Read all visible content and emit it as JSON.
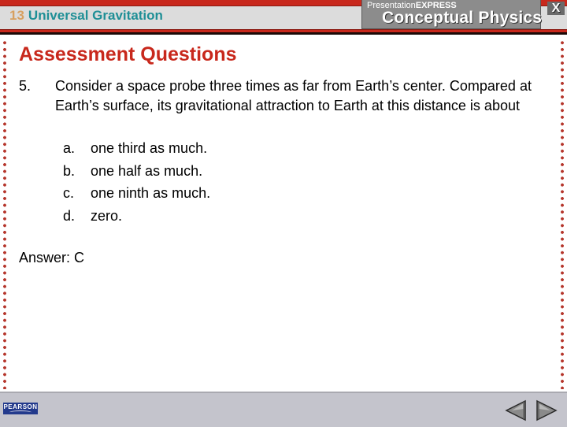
{
  "header": {
    "chapter_number": "13",
    "chapter_title": "Universal Gravitation",
    "brand_small_prefix": "Presentation",
    "brand_small_suffix": "EXPRESS",
    "brand_title": "Conceptual Physics",
    "close_label": "X"
  },
  "slide": {
    "title": "Assessment Questions",
    "question": {
      "number": "5.",
      "text": "Consider a space probe three times as far from Earth’s center. Compared at Earth’s surface, its gravitational attraction to Earth at this distance is about",
      "choices": [
        {
          "letter": "a.",
          "text": "one third as much."
        },
        {
          "letter": "b.",
          "text": "one half as much."
        },
        {
          "letter": "c.",
          "text": "one ninth as much."
        },
        {
          "letter": "d.",
          "text": "zero."
        }
      ]
    },
    "answer": "Answer: C"
  },
  "footer": {
    "logo_text": "PEARSON",
    "prev_icon": "triangle-left",
    "next_icon": "triangle-right"
  },
  "colors": {
    "accent_red": "#c8281c",
    "chapter_teal": "#1f8f96",
    "chapter_number_tan": "#d7a060",
    "pearson_blue": "#233a8c"
  }
}
